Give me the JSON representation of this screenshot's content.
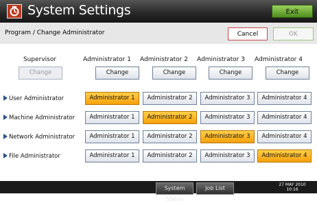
{
  "window": {
    "title": "System Settings",
    "exit_label": "Exit"
  },
  "header": {
    "subtitle": "Program / Change Administrator",
    "cancel_label": "Cancel",
    "ok_label": "OK"
  },
  "columns": [
    {
      "label": "Supervisor",
      "change_label": "Change",
      "enabled": false
    },
    {
      "label": "Administrator 1",
      "change_label": "Change",
      "enabled": true
    },
    {
      "label": "Administrator 2",
      "change_label": "Change",
      "enabled": true
    },
    {
      "label": "Administrator 3",
      "change_label": "Change",
      "enabled": true
    },
    {
      "label": "Administrator 4",
      "change_label": "Change",
      "enabled": true
    }
  ],
  "rows": [
    {
      "label": "User Administrator",
      "options": [
        "Administrator 1",
        "Administrator 2",
        "Administrator 3",
        "Administrator 4"
      ],
      "selected": 0
    },
    {
      "label": "Machine Administrator",
      "options": [
        "Administrator 1",
        "Administrator 2",
        "Administrator 3",
        "Administrator 4"
      ],
      "selected": 1
    },
    {
      "label": "Network Administrator",
      "options": [
        "Administrator 1",
        "Administrator 2",
        "Administrator 3",
        "Administrator 4"
      ],
      "selected": 2
    },
    {
      "label": "File Administrator",
      "options": [
        "Administrator 1",
        "Administrator 2",
        "Administrator 3",
        "Administrator 4"
      ],
      "selected": 3
    }
  ],
  "status": {
    "system_status_label": "System Status",
    "job_list_label": "Job List",
    "date": "27 MAY 2010",
    "time": "10:16"
  },
  "colors": {
    "selected": "#f6a10a",
    "exit_green": "#4f8f1f",
    "cancel_border": "#c44444"
  }
}
